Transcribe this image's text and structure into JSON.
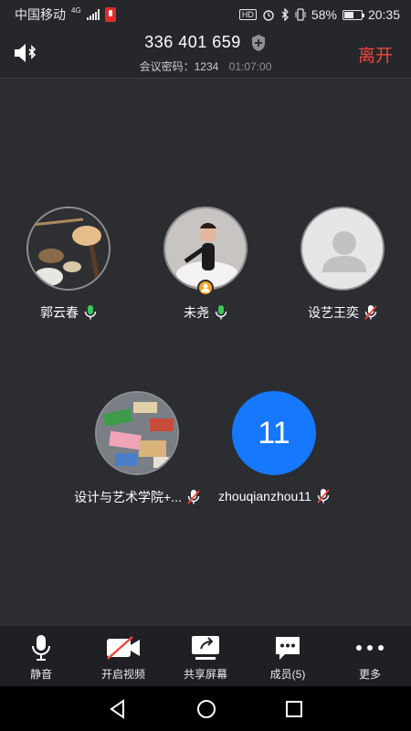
{
  "status_bar": {
    "carrier": "中国移动",
    "network": "4G",
    "hd": "HD",
    "battery": "58%",
    "battery_level": 0.58,
    "time": "20:35"
  },
  "header": {
    "meeting_id": "336 401 659",
    "password_label": "会议密码：1234",
    "duration": "01:07:00",
    "leave_label": "离开"
  },
  "participants": [
    {
      "name": "郭云春",
      "mic": "on",
      "avatar": "photo-spoons"
    },
    {
      "name": "未尧",
      "mic": "on",
      "avatar": "photo-dancer",
      "host": true
    },
    {
      "name": "设艺王奕",
      "mic": "muted",
      "avatar": "default-person"
    },
    {
      "name": "设计与艺术学院+...",
      "mic": "muted",
      "avatar": "photo-blocks"
    },
    {
      "name": "zhouqianzhou11",
      "mic": "muted",
      "avatar": "number",
      "avatar_text": "11"
    }
  ],
  "toolbar": {
    "mute": "静音",
    "video": "开启视频",
    "share": "共享屏幕",
    "members": "成员(5)",
    "more": "更多"
  },
  "colors": {
    "background": "#2b2d31",
    "leave": "#f0463c",
    "mic_on": "#3cc85a",
    "mic_muted": "#f0463c",
    "avatar_blue": "#1677ff"
  }
}
